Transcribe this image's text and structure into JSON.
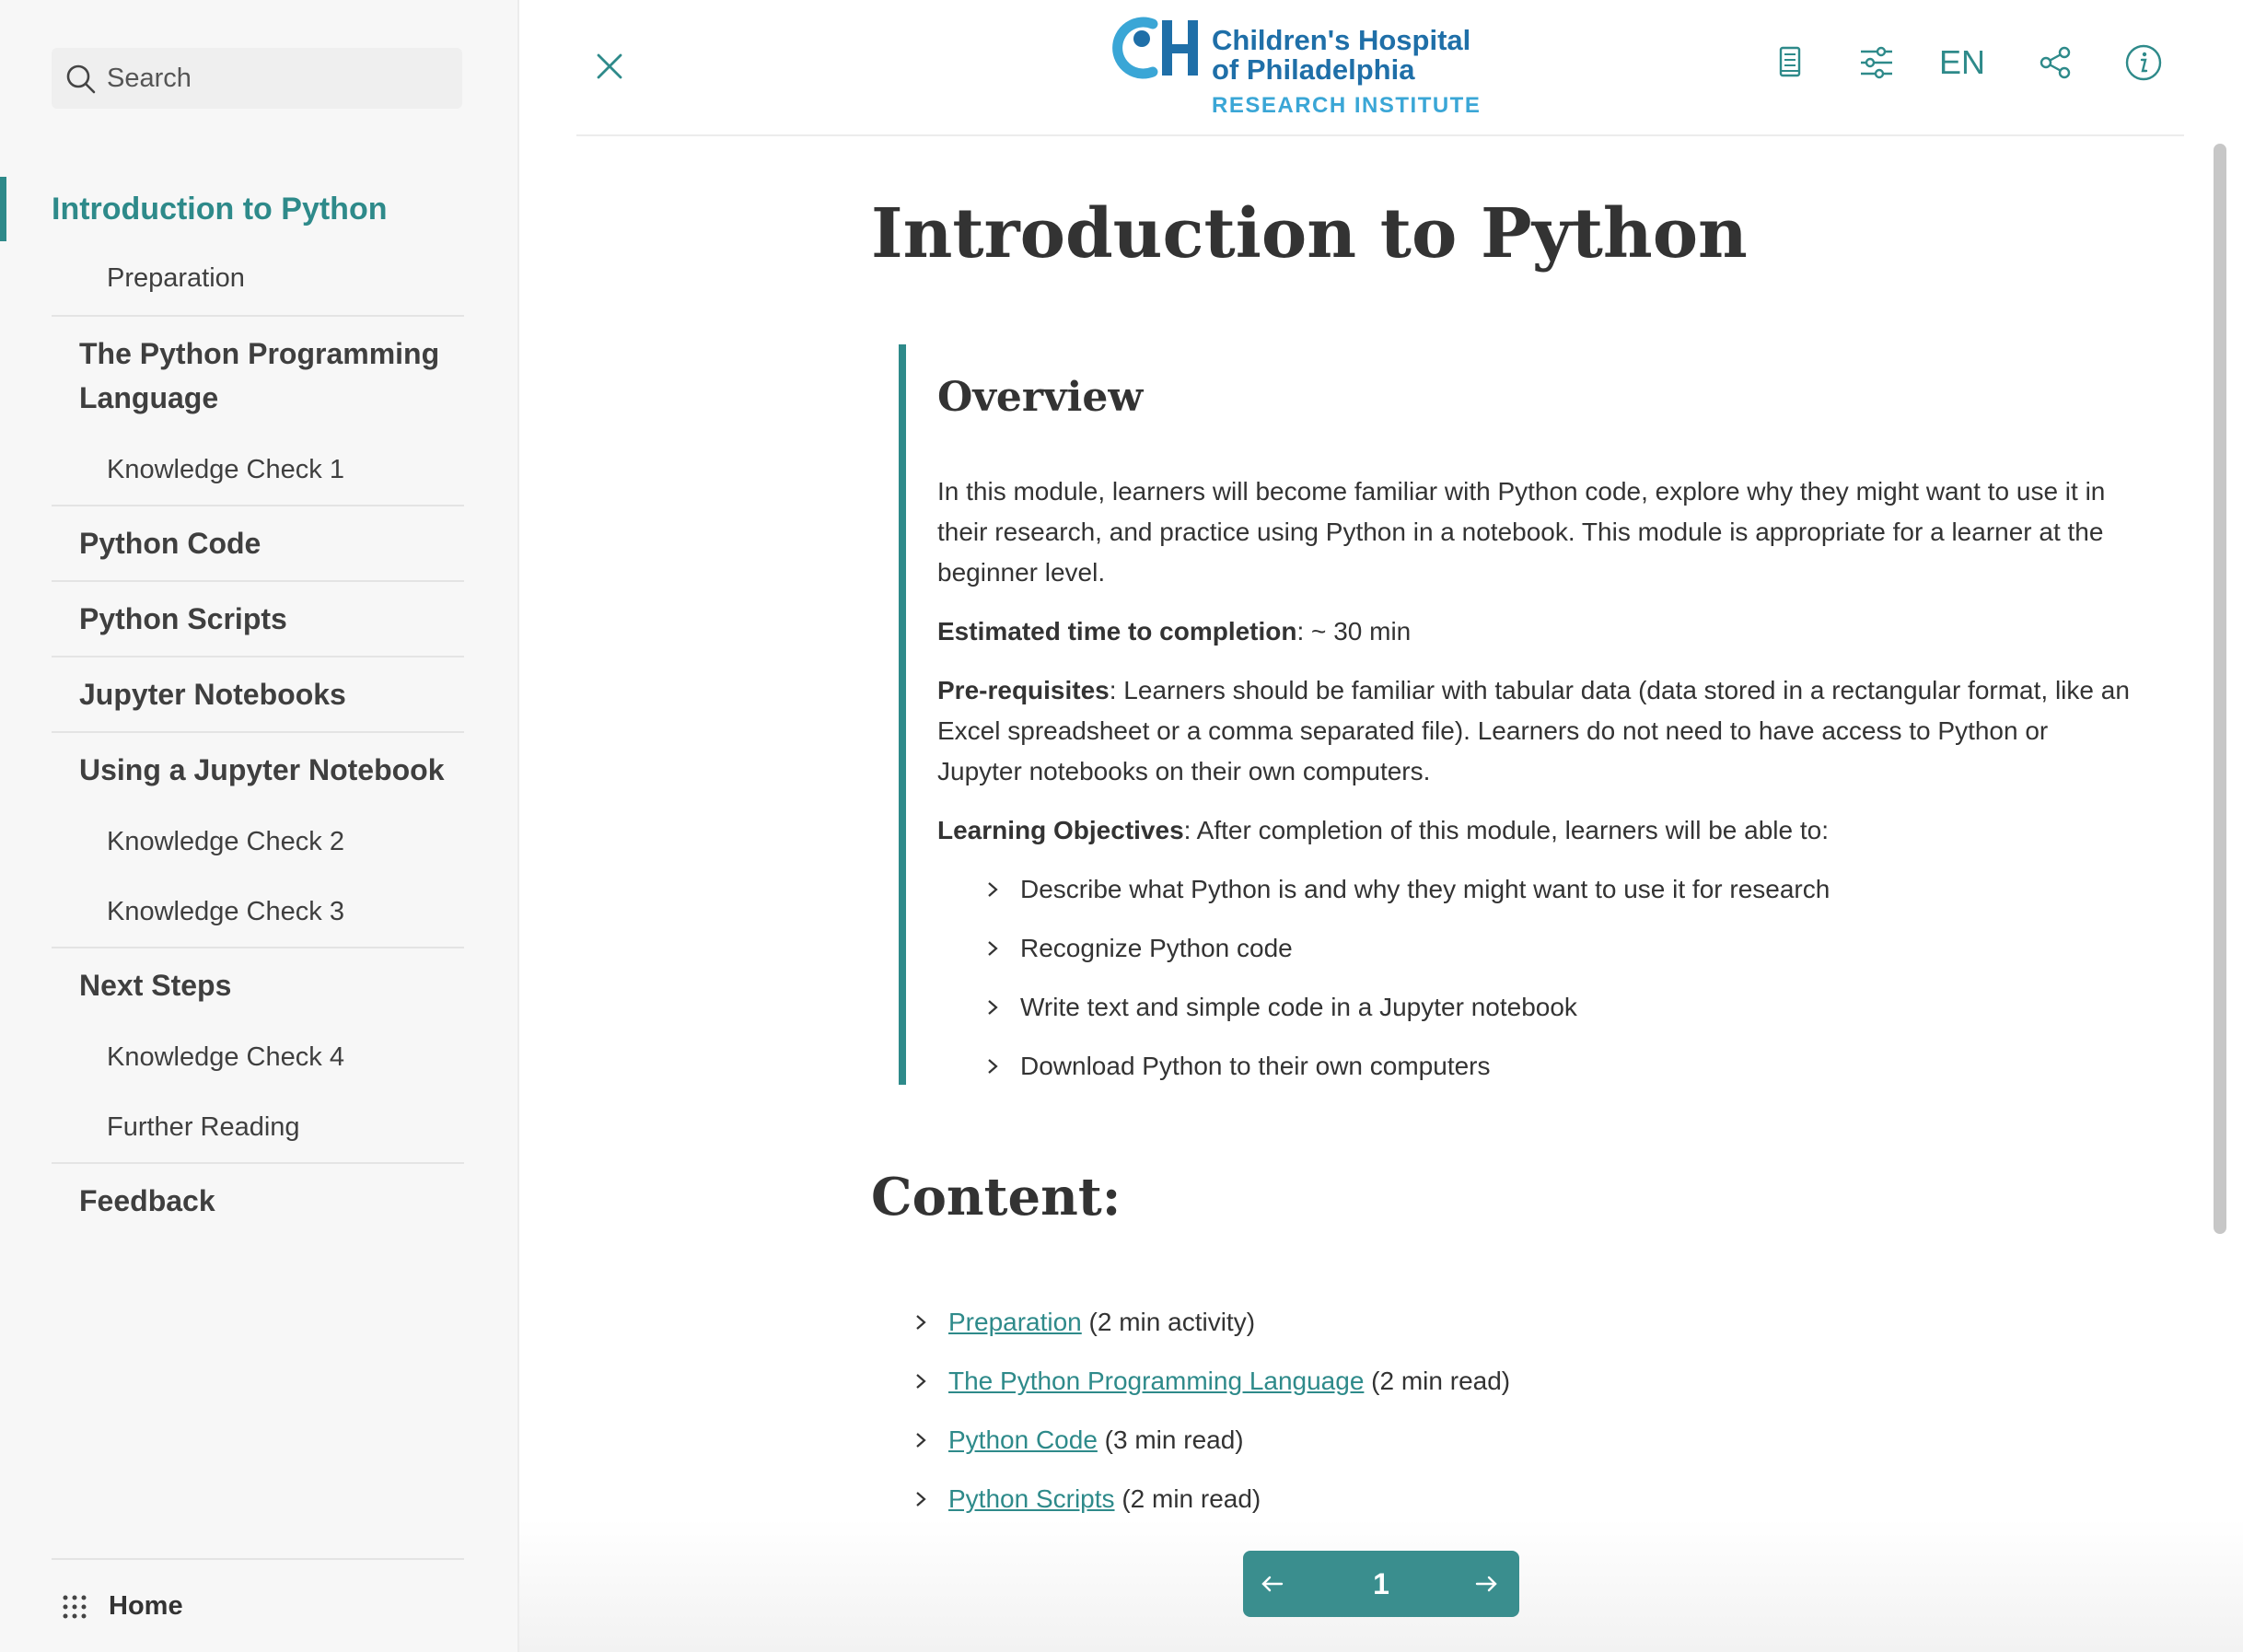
{
  "sidebar": {
    "search_placeholder": "Search",
    "toc": {
      "title": "Introduction to Python",
      "items": [
        {
          "label": "Preparation",
          "level": "sub"
        },
        {
          "label": "The Python Programming Language",
          "level": "main"
        },
        {
          "label": "Knowledge Check 1",
          "level": "sub"
        },
        {
          "label": "Python Code",
          "level": "main"
        },
        {
          "label": "Python Scripts",
          "level": "main"
        },
        {
          "label": "Jupyter Notebooks",
          "level": "main"
        },
        {
          "label": "Using a Jupyter Notebook",
          "level": "main"
        },
        {
          "label": "Knowledge Check 2",
          "level": "sub"
        },
        {
          "label": "Knowledge Check 3",
          "level": "sub"
        },
        {
          "label": "Next Steps",
          "level": "main"
        },
        {
          "label": "Knowledge Check 4",
          "level": "sub"
        },
        {
          "label": "Further Reading",
          "level": "sub"
        },
        {
          "label": "Feedback",
          "level": "main"
        }
      ]
    },
    "home_label": "Home"
  },
  "header": {
    "logo_line1": "Children's Hospital",
    "logo_line2": "of Philadelphia",
    "logo_line3": "RESEARCH INSTITUTE",
    "language": "EN",
    "icons": [
      "close-icon",
      "book-icon",
      "settings-sliders-icon",
      "share-icon",
      "info-icon"
    ]
  },
  "main": {
    "title": "Introduction to Python",
    "overview": {
      "heading": "Overview",
      "intro": "In this module, learners will become familiar with Python code, explore why they might want to use it in their research, and practice using Python in a notebook. This module is appropriate for a learner at the beginner level.",
      "time_label": "Estimated time to completion",
      "time_value": ": ~ 30 min",
      "prereq_label": "Pre-requisites",
      "prereq_value": ": Learners should be familiar with tabular data (data stored in a rectangular format, like an Excel spreadsheet or a comma separated file). Learners do not need to have access to Python or Jupyter notebooks on their own computers.",
      "objectives_label": "Learning Objectives",
      "objectives_value": ": After completion of this module, learners will be able to:",
      "objectives": [
        "Describe what Python is and why they might want to use it for research",
        "Recognize Python code",
        "Write text and simple code in a Jupyter notebook",
        "Download Python to their own computers"
      ]
    },
    "content": {
      "heading": "Content:",
      "items": [
        {
          "link": "Preparation",
          "note": "(2 min activity)"
        },
        {
          "link": "The Python Programming Language",
          "note": "(2 min read)"
        },
        {
          "link": "Python Code",
          "note": "(3 min read)"
        },
        {
          "link": "Python Scripts",
          "note": "(2 min read)"
        }
      ]
    }
  },
  "pager": {
    "page": "1"
  },
  "colors": {
    "accent": "#2e8a8a",
    "logo_blue": "#1f6fa8",
    "logo_light_blue": "#3aa6d6",
    "pager_bg": "#3a8e8e"
  }
}
